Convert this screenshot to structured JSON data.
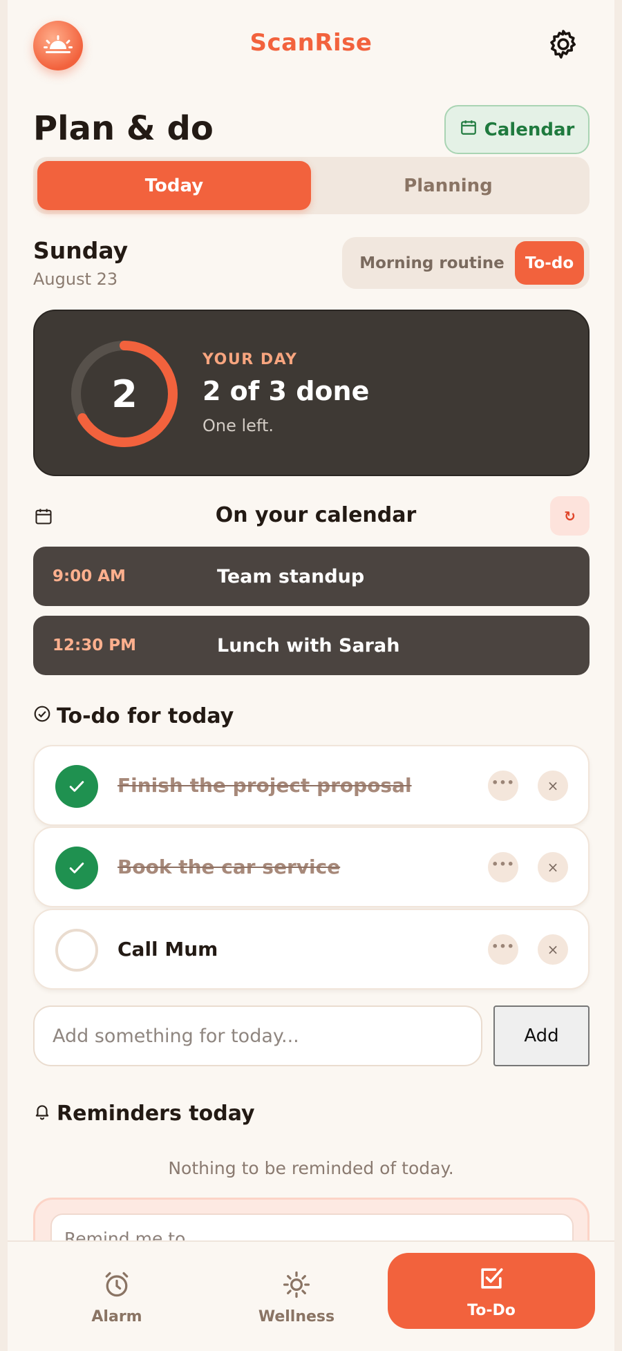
{
  "app": {
    "brand": "ScanRise"
  },
  "header": {
    "page_title": "Plan & do",
    "calendar_button": "Calendar"
  },
  "segments": {
    "today": "Today",
    "planning": "Planning",
    "active": "Today"
  },
  "date": {
    "day_name": "Sunday",
    "date_text": "August 23"
  },
  "mode_toggle": {
    "morning": "Morning routine",
    "todo": "To-do",
    "active": "To-do"
  },
  "summary": {
    "ring_value": "2",
    "done": 2,
    "total": 3,
    "eyebrow": "YOUR DAY",
    "title": "2 of 3 done",
    "subtitle": "One left.",
    "accent_color": "#f2623d"
  },
  "calendar": {
    "title": "On your calendar",
    "refresh_icon": "refresh-icon",
    "events": [
      {
        "time": "9:00 AM",
        "title": "Team standup"
      },
      {
        "time": "12:30 PM",
        "title": "Lunch with Sarah"
      }
    ]
  },
  "todos": {
    "title": "To-do for today",
    "items": [
      {
        "text": "Finish the project proposal",
        "done": true
      },
      {
        "text": "Book the car service",
        "done": true
      },
      {
        "text": "Call Mum",
        "done": false
      }
    ],
    "more_label": "•••",
    "delete_label": "×",
    "input_placeholder": "Add something for today...",
    "add_button": "Add"
  },
  "reminders": {
    "title": "Reminders today",
    "empty_text": "Nothing to be reminded of today.",
    "input_placeholder": "Remind me to..."
  },
  "nav": {
    "items": [
      {
        "label": "Alarm",
        "icon": "alarm-clock-icon"
      },
      {
        "label": "Wellness",
        "icon": "sun-icon"
      },
      {
        "label": "To-Do",
        "icon": "checkbox-icon"
      }
    ],
    "active": "To-Do"
  },
  "colors": {
    "accent": "#f2623d",
    "success": "#1f9150",
    "dark_card": "#3e3934",
    "background": "#fbf7f2"
  }
}
